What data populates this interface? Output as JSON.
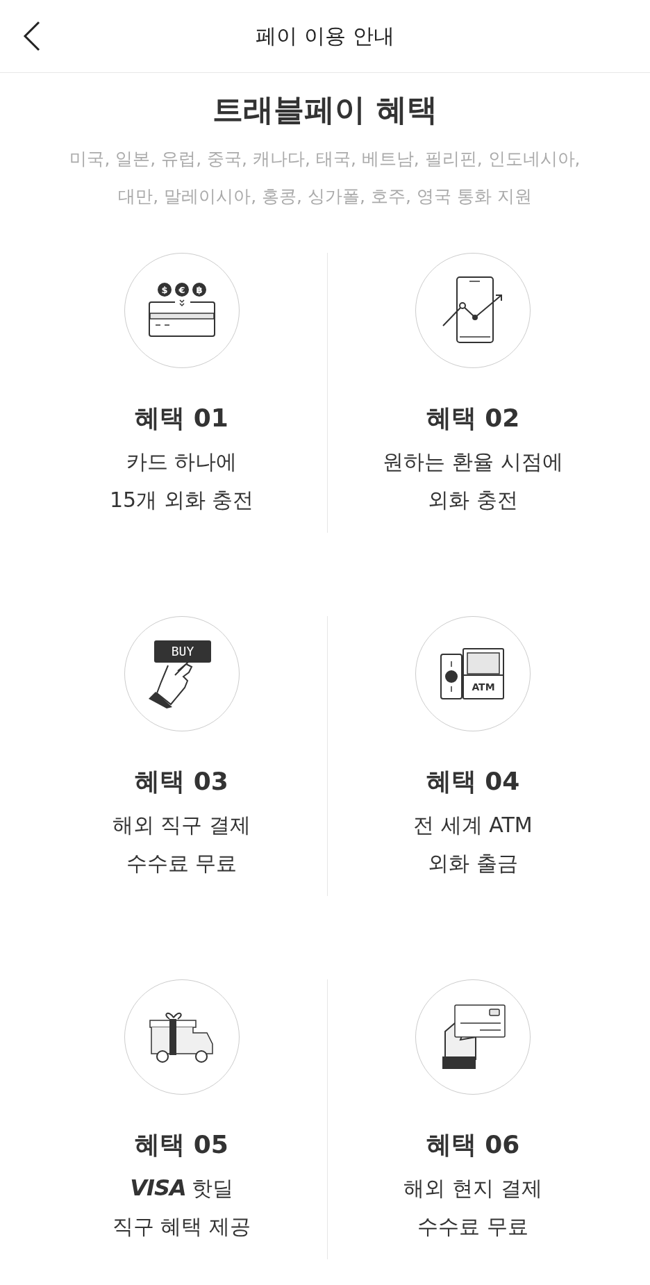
{
  "header": {
    "title": "페이 이용 안내"
  },
  "intro": {
    "title": "트래블페이 혜택",
    "description": [
      "미국, 일본, 유럽, 중국, 캐나다, 태국, 베트남, 필리핀, 인도네시아,",
      "대만, 말레이시아, 홍콩, 싱가폴, 호주, 영국 통화 지원"
    ]
  },
  "benefits": [
    {
      "icon_text": [
        "$",
        "€",
        "฿"
      ],
      "heading": "혜택 01",
      "lines": [
        "카드 하나에",
        "15개 외화 충전"
      ]
    },
    {
      "heading": "혜택 02",
      "lines": [
        "원하는 환율 시점에",
        "외화 충전"
      ]
    },
    {
      "icon_text": [
        "BUY"
      ],
      "heading": "혜택 03",
      "lines": [
        "해외 직구 결제",
        "수수료 무료"
      ]
    },
    {
      "icon_text": [
        "ATM"
      ],
      "heading": "혜택 04",
      "lines": [
        "전 세계 ATM",
        "외화 출금"
      ]
    },
    {
      "heading": "혜택 05",
      "logo": "VISA",
      "lines": [
        "핫딜",
        "직구 혜택 제공"
      ]
    },
    {
      "heading": "혜택 06",
      "lines": [
        "해외 현지 결제",
        "수수료 무료"
      ]
    }
  ]
}
